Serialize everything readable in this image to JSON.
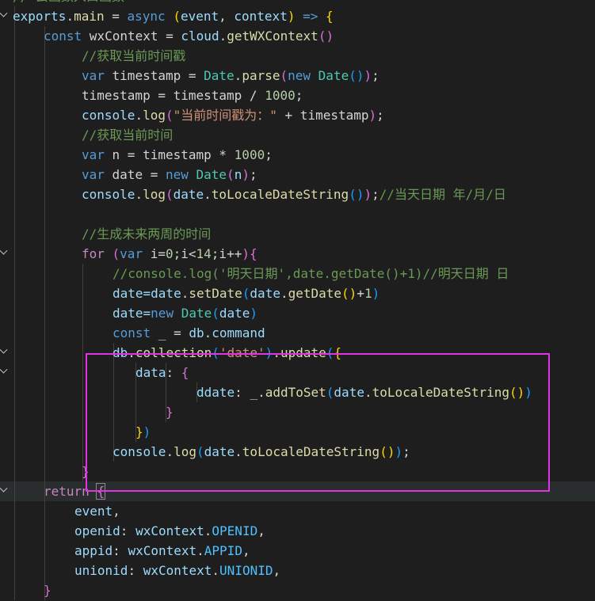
{
  "editor": {
    "lines": [
      {
        "indent": 16,
        "fold": false,
        "highlight": false,
        "segments": [
          {
            "t": "// 云函数入口函数",
            "c": "#6a9955"
          }
        ]
      },
      {
        "indent": 16,
        "fold": true,
        "highlight": false,
        "segments": [
          {
            "t": "exports",
            "c": "#9cdcfe"
          },
          {
            "t": ".",
            "c": "#d4d4d4"
          },
          {
            "t": "main",
            "c": "#dcdcaa"
          },
          {
            "t": " = ",
            "c": "#d4d4d4"
          },
          {
            "t": "async",
            "c": "#569cd6"
          },
          {
            "t": " (",
            "c": "#ffd700"
          },
          {
            "t": "event",
            "c": "#9cdcfe"
          },
          {
            "t": ", ",
            "c": "#d4d4d4"
          },
          {
            "t": "context",
            "c": "#9cdcfe"
          },
          {
            "t": ")",
            "c": "#ffd700"
          },
          {
            "t": " => ",
            "c": "#569cd6"
          },
          {
            "t": "{",
            "c": "#ffd700"
          }
        ]
      },
      {
        "indent": 55,
        "fold": false,
        "highlight": false,
        "segments": [
          {
            "t": "const",
            "c": "#569cd6"
          },
          {
            "t": " wxContext = ",
            "c": "#d4d4d4"
          },
          {
            "t": "cloud",
            "c": "#9cdcfe"
          },
          {
            "t": ".",
            "c": "#d4d4d4"
          },
          {
            "t": "getWXContext",
            "c": "#dcdcaa"
          },
          {
            "t": "()",
            "c": "#da70d6"
          }
        ]
      },
      {
        "indent": 103,
        "fold": false,
        "highlight": false,
        "segments": [
          {
            "t": "//获取当前时间戳",
            "c": "#6a9955"
          }
        ]
      },
      {
        "indent": 103,
        "fold": false,
        "highlight": false,
        "segments": [
          {
            "t": "var",
            "c": "#569cd6"
          },
          {
            "t": " timestamp = ",
            "c": "#d4d4d4"
          },
          {
            "t": "Date",
            "c": "#4ec9b0"
          },
          {
            "t": ".",
            "c": "#d4d4d4"
          },
          {
            "t": "parse",
            "c": "#dcdcaa"
          },
          {
            "t": "(",
            "c": "#da70d6"
          },
          {
            "t": "new",
            "c": "#569cd6"
          },
          {
            "t": " ",
            "c": "#d4d4d4"
          },
          {
            "t": "Date",
            "c": "#4ec9b0"
          },
          {
            "t": "()",
            "c": "#179fff"
          },
          {
            "t": ")",
            "c": "#da70d6"
          },
          {
            "t": ";",
            "c": "#d4d4d4"
          }
        ]
      },
      {
        "indent": 103,
        "fold": false,
        "highlight": false,
        "segments": [
          {
            "t": "timestamp = timestamp / ",
            "c": "#d4d4d4"
          },
          {
            "t": "1000",
            "c": "#b5cea8"
          },
          {
            "t": ";",
            "c": "#d4d4d4"
          }
        ]
      },
      {
        "indent": 103,
        "fold": false,
        "highlight": false,
        "segments": [
          {
            "t": "console",
            "c": "#9cdcfe"
          },
          {
            "t": ".",
            "c": "#d4d4d4"
          },
          {
            "t": "log",
            "c": "#dcdcaa"
          },
          {
            "t": "(",
            "c": "#da70d6"
          },
          {
            "t": "\"当前时间戳为：\"",
            "c": "#ce9178"
          },
          {
            "t": " + timestamp",
            "c": "#d4d4d4"
          },
          {
            "t": ")",
            "c": "#da70d6"
          },
          {
            "t": ";",
            "c": "#d4d4d4"
          }
        ]
      },
      {
        "indent": 103,
        "fold": false,
        "highlight": false,
        "segments": [
          {
            "t": "//获取当前时间",
            "c": "#6a9955"
          }
        ]
      },
      {
        "indent": 103,
        "fold": false,
        "highlight": false,
        "segments": [
          {
            "t": "var",
            "c": "#569cd6"
          },
          {
            "t": " n = timestamp * ",
            "c": "#d4d4d4"
          },
          {
            "t": "1000",
            "c": "#b5cea8"
          },
          {
            "t": ";",
            "c": "#d4d4d4"
          }
        ]
      },
      {
        "indent": 103,
        "fold": false,
        "highlight": false,
        "segments": [
          {
            "t": "var",
            "c": "#569cd6"
          },
          {
            "t": " date = ",
            "c": "#d4d4d4"
          },
          {
            "t": "new",
            "c": "#569cd6"
          },
          {
            "t": " ",
            "c": "#d4d4d4"
          },
          {
            "t": "Date",
            "c": "#4ec9b0"
          },
          {
            "t": "(",
            "c": "#da70d6"
          },
          {
            "t": "n",
            "c": "#9cdcfe"
          },
          {
            "t": ")",
            "c": "#da70d6"
          },
          {
            "t": ";",
            "c": "#d4d4d4"
          }
        ]
      },
      {
        "indent": 103,
        "fold": false,
        "highlight": false,
        "segments": [
          {
            "t": "console",
            "c": "#9cdcfe"
          },
          {
            "t": ".",
            "c": "#d4d4d4"
          },
          {
            "t": "log",
            "c": "#dcdcaa"
          },
          {
            "t": "(",
            "c": "#da70d6"
          },
          {
            "t": "date",
            "c": "#9cdcfe"
          },
          {
            "t": ".",
            "c": "#d4d4d4"
          },
          {
            "t": "toLocaleDateString",
            "c": "#dcdcaa"
          },
          {
            "t": "()",
            "c": "#179fff"
          },
          {
            "t": ")",
            "c": "#da70d6"
          },
          {
            "t": ";",
            "c": "#d4d4d4"
          },
          {
            "t": "//当天日期 年/月/日",
            "c": "#6a9955"
          }
        ]
      },
      {
        "indent": 103,
        "fold": false,
        "highlight": false,
        "segments": [
          {
            "t": "",
            "c": "#d4d4d4"
          }
        ]
      },
      {
        "indent": 103,
        "fold": false,
        "highlight": false,
        "segments": [
          {
            "t": "//生成未来两周的时间",
            "c": "#6a9955"
          }
        ]
      },
      {
        "indent": 103,
        "fold": true,
        "highlight": false,
        "segments": [
          {
            "t": "for",
            "c": "#c586c0"
          },
          {
            "t": " (",
            "c": "#da70d6"
          },
          {
            "t": "var",
            "c": "#569cd6"
          },
          {
            "t": " i=",
            "c": "#d4d4d4"
          },
          {
            "t": "0",
            "c": "#b5cea8"
          },
          {
            "t": ";i<",
            "c": "#d4d4d4"
          },
          {
            "t": "14",
            "c": "#b5cea8"
          },
          {
            "t": ";i++",
            "c": "#d4d4d4"
          },
          {
            "t": ")",
            "c": "#da70d6"
          },
          {
            "t": "{",
            "c": "#da70d6"
          }
        ]
      },
      {
        "indent": 142,
        "fold": false,
        "highlight": false,
        "segments": [
          {
            "t": "//console.log('明天日期',date.getDate()+1)//明天日期 日",
            "c": "#6a9955"
          }
        ]
      },
      {
        "indent": 142,
        "fold": false,
        "highlight": false,
        "segments": [
          {
            "t": "date=date",
            "c": "#9cdcfe"
          },
          {
            "t": ".",
            "c": "#d4d4d4"
          },
          {
            "t": "setDate",
            "c": "#dcdcaa"
          },
          {
            "t": "(",
            "c": "#179fff"
          },
          {
            "t": "date",
            "c": "#9cdcfe"
          },
          {
            "t": ".",
            "c": "#d4d4d4"
          },
          {
            "t": "getDate",
            "c": "#dcdcaa"
          },
          {
            "t": "()",
            "c": "#ffd700"
          },
          {
            "t": "+",
            "c": "#d4d4d4"
          },
          {
            "t": "1",
            "c": "#b5cea8"
          },
          {
            "t": ")",
            "c": "#179fff"
          }
        ]
      },
      {
        "indent": 142,
        "fold": false,
        "highlight": false,
        "segments": [
          {
            "t": "date=",
            "c": "#9cdcfe"
          },
          {
            "t": "new",
            "c": "#569cd6"
          },
          {
            "t": " ",
            "c": "#d4d4d4"
          },
          {
            "t": "Date",
            "c": "#4ec9b0"
          },
          {
            "t": "(",
            "c": "#179fff"
          },
          {
            "t": "date",
            "c": "#9cdcfe"
          },
          {
            "t": ")",
            "c": "#179fff"
          }
        ]
      },
      {
        "indent": 142,
        "fold": false,
        "highlight": false,
        "segments": [
          {
            "t": "const",
            "c": "#569cd6"
          },
          {
            "t": " _ = ",
            "c": "#d4d4d4"
          },
          {
            "t": "db",
            "c": "#9cdcfe"
          },
          {
            "t": ".",
            "c": "#d4d4d4"
          },
          {
            "t": "command",
            "c": "#9cdcfe"
          }
        ]
      },
      {
        "indent": 142,
        "fold": true,
        "highlight": false,
        "segments": [
          {
            "t": "db",
            "c": "#9cdcfe"
          },
          {
            "t": ".",
            "c": "#d4d4d4"
          },
          {
            "t": "collection",
            "c": "#dcdcaa"
          },
          {
            "t": "(",
            "c": "#179fff"
          },
          {
            "t": "'date'",
            "c": "#ce9178"
          },
          {
            "t": ")",
            "c": "#179fff"
          },
          {
            "t": ".",
            "c": "#d4d4d4"
          },
          {
            "t": "update",
            "c": "#dcdcaa"
          },
          {
            "t": "(",
            "c": "#179fff"
          },
          {
            "t": "{",
            "c": "#ffd700"
          }
        ]
      },
      {
        "indent": 171,
        "fold": true,
        "highlight": false,
        "segments": [
          {
            "t": "data",
            "c": "#9cdcfe"
          },
          {
            "t": ": ",
            "c": "#d4d4d4"
          },
          {
            "t": "{",
            "c": "#da70d6"
          }
        ]
      },
      {
        "indent": 248,
        "fold": false,
        "highlight": false,
        "segments": [
          {
            "t": "ddate",
            "c": "#9cdcfe"
          },
          {
            "t": ": ",
            "c": "#d4d4d4"
          },
          {
            "t": "_",
            "c": "#9cdcfe"
          },
          {
            "t": ".",
            "c": "#d4d4d4"
          },
          {
            "t": "addToSet",
            "c": "#dcdcaa"
          },
          {
            "t": "(",
            "c": "#179fff"
          },
          {
            "t": "date",
            "c": "#9cdcfe"
          },
          {
            "t": ".",
            "c": "#d4d4d4"
          },
          {
            "t": "toLocaleDateString",
            "c": "#dcdcaa"
          },
          {
            "t": "()",
            "c": "#ffd700"
          },
          {
            "t": ")",
            "c": "#179fff"
          }
        ]
      },
      {
        "indent": 209,
        "fold": false,
        "highlight": false,
        "segments": [
          {
            "t": "}",
            "c": "#da70d6"
          }
        ]
      },
      {
        "indent": 171,
        "fold": false,
        "highlight": false,
        "segments": [
          {
            "t": "}",
            "c": "#ffd700"
          },
          {
            "t": ")",
            "c": "#179fff"
          }
        ]
      },
      {
        "indent": 142,
        "fold": false,
        "highlight": false,
        "segments": [
          {
            "t": "console",
            "c": "#9cdcfe"
          },
          {
            "t": ".",
            "c": "#d4d4d4"
          },
          {
            "t": "log",
            "c": "#dcdcaa"
          },
          {
            "t": "(",
            "c": "#179fff"
          },
          {
            "t": "date",
            "c": "#9cdcfe"
          },
          {
            "t": ".",
            "c": "#d4d4d4"
          },
          {
            "t": "toLocaleDateString",
            "c": "#dcdcaa"
          },
          {
            "t": "()",
            "c": "#ffd700"
          },
          {
            "t": ")",
            "c": "#179fff"
          },
          {
            "t": ";",
            "c": "#d4d4d4"
          }
        ]
      },
      {
        "indent": 103,
        "fold": false,
        "highlight": false,
        "segments": [
          {
            "t": "}",
            "c": "#da70d6"
          }
        ]
      },
      {
        "indent": 55,
        "fold": true,
        "highlight": true,
        "segments": [
          {
            "t": "return",
            "c": "#c586c0"
          },
          {
            "t": " ",
            "c": "#d4d4d4"
          },
          {
            "t": "{",
            "c": "#da70d6"
          }
        ]
      },
      {
        "indent": 94,
        "fold": false,
        "highlight": false,
        "segments": [
          {
            "t": "event",
            "c": "#9cdcfe"
          },
          {
            "t": ",",
            "c": "#d4d4d4"
          }
        ]
      },
      {
        "indent": 94,
        "fold": false,
        "highlight": false,
        "segments": [
          {
            "t": "openid",
            "c": "#9cdcfe"
          },
          {
            "t": ": ",
            "c": "#d4d4d4"
          },
          {
            "t": "wxContext",
            "c": "#9cdcfe"
          },
          {
            "t": ".",
            "c": "#d4d4d4"
          },
          {
            "t": "OPENID",
            "c": "#4fc1ff"
          },
          {
            "t": ",",
            "c": "#d4d4d4"
          }
        ]
      },
      {
        "indent": 94,
        "fold": false,
        "highlight": false,
        "segments": [
          {
            "t": "appid",
            "c": "#9cdcfe"
          },
          {
            "t": ": ",
            "c": "#d4d4d4"
          },
          {
            "t": "wxContext",
            "c": "#9cdcfe"
          },
          {
            "t": ".",
            "c": "#d4d4d4"
          },
          {
            "t": "APPID",
            "c": "#4fc1ff"
          },
          {
            "t": ",",
            "c": "#d4d4d4"
          }
        ]
      },
      {
        "indent": 94,
        "fold": false,
        "highlight": false,
        "segments": [
          {
            "t": "unionid",
            "c": "#9cdcfe"
          },
          {
            "t": ": ",
            "c": "#d4d4d4"
          },
          {
            "t": "wxContext",
            "c": "#9cdcfe"
          },
          {
            "t": ".",
            "c": "#d4d4d4"
          },
          {
            "t": "UNIONID",
            "c": "#4fc1ff"
          },
          {
            "t": ",",
            "c": "#d4d4d4"
          }
        ]
      },
      {
        "indent": 55,
        "fold": false,
        "highlight": false,
        "segments": [
          {
            "t": "}",
            "c": "#da70d6"
          }
        ]
      }
    ]
  },
  "annotation": {
    "color": "#e133e1"
  }
}
